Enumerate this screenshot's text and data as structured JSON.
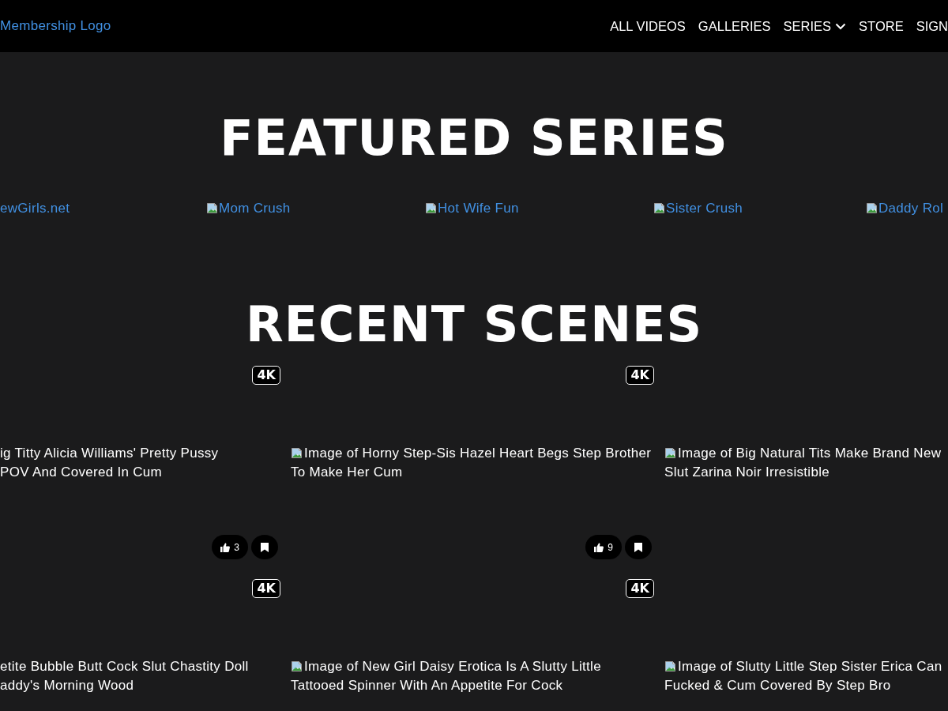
{
  "header": {
    "logo": "Membership Logo",
    "nav": [
      {
        "label": "ALL VIDEOS",
        "kind": "link"
      },
      {
        "label": "GALLERIES",
        "kind": "link"
      },
      {
        "label": "SERIES",
        "kind": "dropdown"
      },
      {
        "label": "STORE",
        "kind": "link"
      },
      {
        "label": "SIGN",
        "kind": "link"
      }
    ]
  },
  "featured_series": {
    "title": "FEATURED SERIES",
    "items": [
      {
        "label": "ewGirls.net",
        "kind": "text"
      },
      {
        "label": "Mom Crush",
        "kind": "broken_image"
      },
      {
        "label": "Hot Wife Fun",
        "kind": "broken_image"
      },
      {
        "label": "Sister Crush",
        "kind": "broken_image"
      },
      {
        "label": "Daddy Rol",
        "kind": "broken_image"
      }
    ]
  },
  "recent_scenes": {
    "title": "RECENT SCENES",
    "scenes": [
      {
        "kind": "clipped",
        "title_lines": [
          "ig Titty Alicia Williams' Pretty Pussy",
          "POV And Covered In Cum"
        ],
        "badge": "4K",
        "actions": {
          "likes": "3"
        }
      },
      {
        "kind": "broken_image",
        "title_lines": [
          "Image of Horny Step-Sis Hazel Heart Begs Step Brother",
          "To Make Her Cum"
        ],
        "badge": "4K",
        "actions": {
          "likes": "9"
        }
      },
      {
        "kind": "broken_image",
        "title_lines": [
          "Image of Big Natural Tits Make Brand New",
          "Slut Zarina Noir Irresistible"
        ]
      },
      {
        "kind": "clipped",
        "title_lines": [
          "etite Bubble Butt Cock Slut Chastity Doll",
          "addy's Morning Wood"
        ],
        "badge": "4K"
      },
      {
        "kind": "broken_image",
        "title_lines": [
          "Image of New Girl Daisy Erotica Is A Slutty Little",
          "Tattooed Spinner With An Appetite For Cock"
        ],
        "badge": "4K"
      },
      {
        "kind": "broken_image",
        "title_lines": [
          "Image of Slutty Little Step Sister Erica Can",
          "Fucked & Cum Covered By Step Bro"
        ]
      }
    ]
  }
}
